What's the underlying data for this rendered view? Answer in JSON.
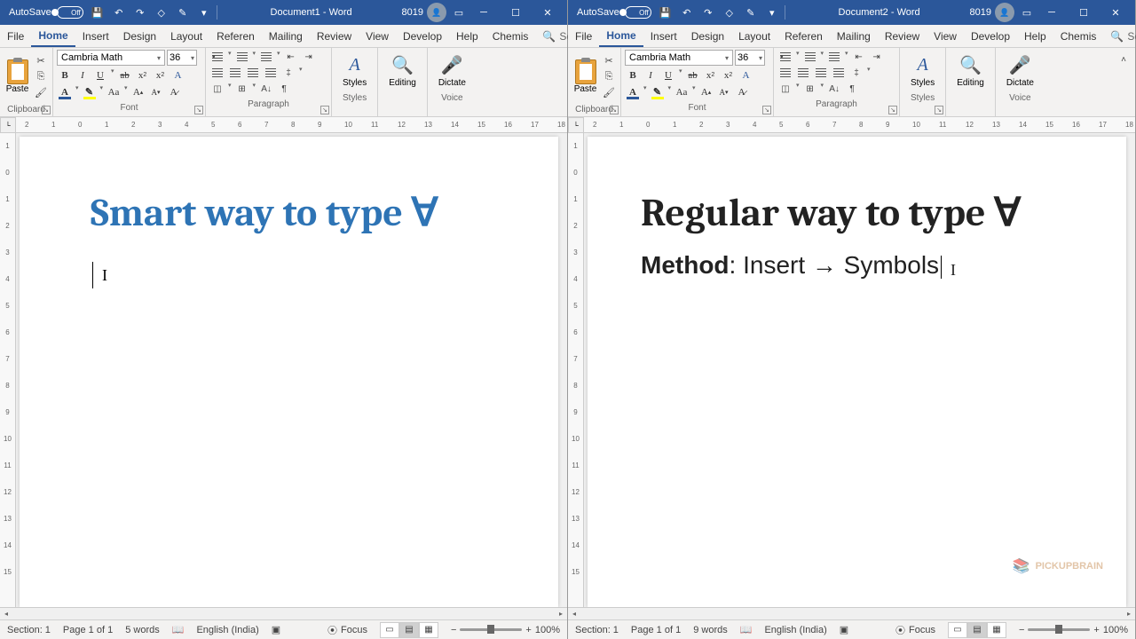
{
  "left": {
    "titlebar": {
      "autosave": "AutoSave",
      "toggle": "Off",
      "doc": "Document1 - Word",
      "user": "8019"
    },
    "tabs": [
      "File",
      "Home",
      "Insert",
      "Design",
      "Layout",
      "Referen",
      "Mailing",
      "Review",
      "View",
      "Develop",
      "Help",
      "Chemis"
    ],
    "activeTab": 1,
    "search": "Search",
    "font": {
      "name": "Cambria Math",
      "size": "36"
    },
    "groups": {
      "clipboard": "Clipboard",
      "paste": "Paste",
      "font": "Font",
      "paragraph": "Paragraph",
      "styles": "Styles",
      "editing": "Editing",
      "voice": "Voice",
      "stylesBtn": "Styles",
      "editingBtn": "Editing",
      "dictate": "Dictate"
    },
    "content": {
      "heading": "Smart way to type ∀"
    },
    "status": {
      "section": "Section: 1",
      "page": "Page 1 of 1",
      "words": "5 words",
      "lang": "English (India)",
      "focus": "Focus",
      "zoom": "100%"
    }
  },
  "right": {
    "titlebar": {
      "autosave": "AutoSave",
      "toggle": "Off",
      "doc": "Document2 - Word",
      "user": "8019"
    },
    "tabs": [
      "File",
      "Home",
      "Insert",
      "Design",
      "Layout",
      "Referen",
      "Mailing",
      "Review",
      "View",
      "Develop",
      "Help",
      "Chemis"
    ],
    "activeTab": 1,
    "search": "Search",
    "font": {
      "name": "Cambria Math",
      "size": "36"
    },
    "groups": {
      "clipboard": "Clipboard",
      "paste": "Paste",
      "font": "Font",
      "paragraph": "Paragraph",
      "styles": "Styles",
      "editing": "Editing",
      "voice": "Voice",
      "stylesBtn": "Styles",
      "editingBtn": "Editing",
      "dictate": "Dictate"
    },
    "content": {
      "heading": "Regular way to type ∀",
      "method_label": "Method",
      "method_body": ": Insert → Symbols"
    },
    "status": {
      "section": "Section: 1",
      "page": "Page 1 of 1",
      "words": "9 words",
      "lang": "English (India)",
      "focus": "Focus",
      "zoom": "100%"
    },
    "watermark": "PICKUPBRAIN"
  }
}
